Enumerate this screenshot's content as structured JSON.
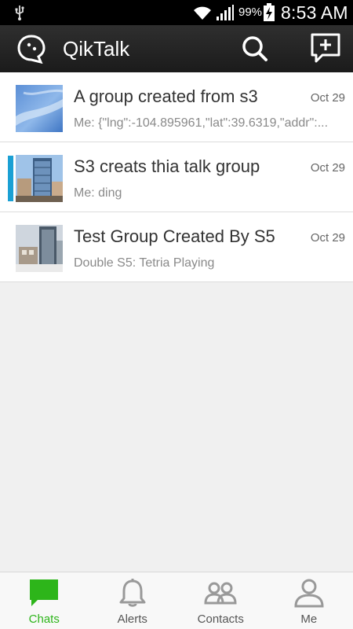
{
  "status_bar": {
    "battery_percent": "99%",
    "time": "8:53 AM"
  },
  "action_bar": {
    "title": "QikTalk",
    "logo_icon": "qiktalk-logo-icon",
    "search_icon": "search-icon",
    "compose_icon": "new-chat-icon"
  },
  "chats": [
    {
      "title": "A group created from s3",
      "date": "Oct 29",
      "preview": "Me: {\"lng\":-104.895961,\"lat\":39.6319,\"addr\":...",
      "unread": false,
      "avatar": "sky-photo"
    },
    {
      "title": "S3 creats thia talk group",
      "date": "Oct 29",
      "preview": "Me: ding",
      "unread": true,
      "avatar": "building-photo"
    },
    {
      "title": "Test Group Created By S5",
      "date": "Oct 29",
      "preview": "Double S5: Tetria Playing",
      "unread": false,
      "avatar": "city-photo"
    }
  ],
  "bottom_nav": {
    "items": [
      {
        "label": "Chats",
        "icon": "chat-bubble-icon",
        "active": true
      },
      {
        "label": "Alerts",
        "icon": "bell-icon",
        "active": false
      },
      {
        "label": "Contacts",
        "icon": "contacts-icon",
        "active": false
      },
      {
        "label": "Me",
        "icon": "person-icon",
        "active": false
      }
    ]
  },
  "colors": {
    "accent_green": "#2db51a",
    "unread_marker": "#1aa0d4",
    "action_bar": "#262626"
  }
}
